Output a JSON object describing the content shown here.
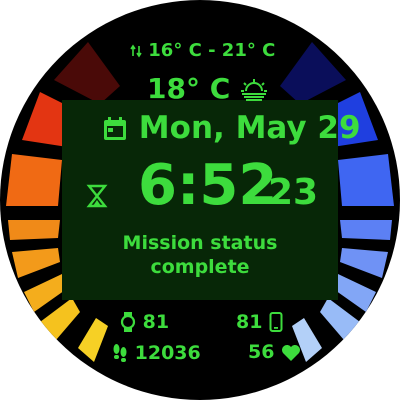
{
  "weather": {
    "range_text": "16° C - 21° C",
    "current_temp": "18° C",
    "icon": "sunrise-icon",
    "range_icon": "up-down-arrows-icon"
  },
  "date": {
    "text": "Mon, May 29",
    "icon": "calendar-icon"
  },
  "time": {
    "hours_minutes": "6:52",
    "seconds": "23",
    "left_icon": "hourglass-icon"
  },
  "status": {
    "line1": "Mission status",
    "line2": "complete"
  },
  "stats": {
    "watch_battery": "81",
    "phone_battery": "81",
    "steps": "12036",
    "heart_rate": "56"
  },
  "colors": {
    "accent": "#3ddc3d",
    "panel": "#072707",
    "background": "#000000"
  }
}
